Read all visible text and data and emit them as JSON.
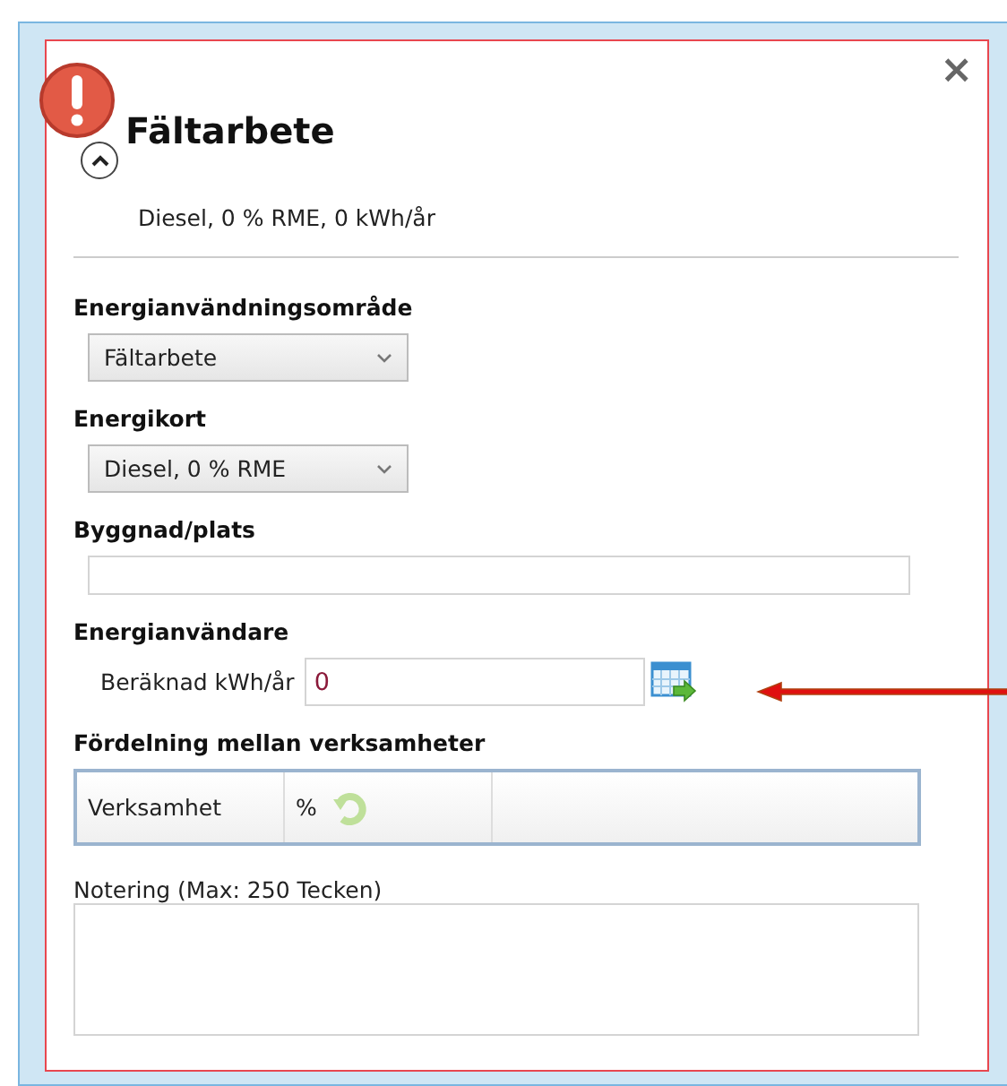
{
  "panel": {
    "title": "Fältarbete",
    "summary": "Diesel, 0 % RME, 0 kWh/år",
    "close": "×",
    "expanded": true,
    "warning": true
  },
  "sections": [
    {
      "kind": "dropdown",
      "label": "Energianvändningsområde",
      "value": "Fältarbete"
    },
    {
      "kind": "dropdown",
      "label": "Energikort",
      "value": "Diesel, 0 % RME"
    },
    {
      "kind": "text",
      "label": "Byggnad/plats"
    },
    {
      "kind": "calc",
      "label": "Energianvändare",
      "field": {
        "label": "Beräknad kWh/år",
        "value": "0"
      }
    },
    {
      "kind": "grid",
      "label": "Fördelning mellan verksamheter",
      "columns": [
        "Verksamhet",
        "%"
      ]
    }
  ],
  "note": {
    "label": "Notering (Max: 250 Tecken)"
  }
}
